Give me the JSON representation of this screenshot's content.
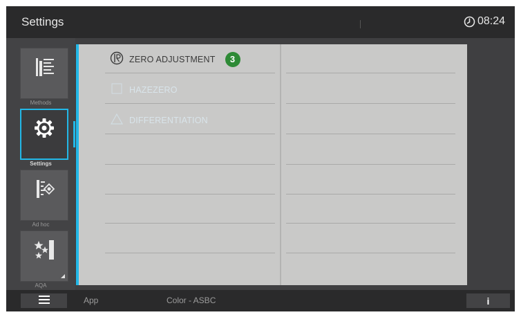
{
  "header": {
    "title": "Settings",
    "time": "08:24"
  },
  "sidebar": {
    "items": [
      {
        "label": "Methods",
        "icon": "methods-icon",
        "active": false
      },
      {
        "label": "Settings",
        "icon": "gear-icon",
        "active": true
      },
      {
        "label": "Ad hoc",
        "icon": "adhoc-icon",
        "active": false
      },
      {
        "label": "AQA",
        "icon": "aqa-icon",
        "active": false
      }
    ]
  },
  "main": {
    "items": [
      {
        "label": "ZERO ADJUSTMENT",
        "icon": "zero-adjustment-icon",
        "badge": "3"
      },
      {
        "label": "HAZEZERO",
        "icon": "blank-icon"
      },
      {
        "label": "DIFFERENTIATION",
        "icon": "triangle-icon"
      }
    ]
  },
  "footer": {
    "app_label": "App",
    "mode_label": "Color - ASBC",
    "info_label": "i"
  },
  "colors": {
    "accent": "#22b8e8",
    "badge": "#2e8a36",
    "bar": "#2a2a2b",
    "panel": "#c9c9c8"
  }
}
